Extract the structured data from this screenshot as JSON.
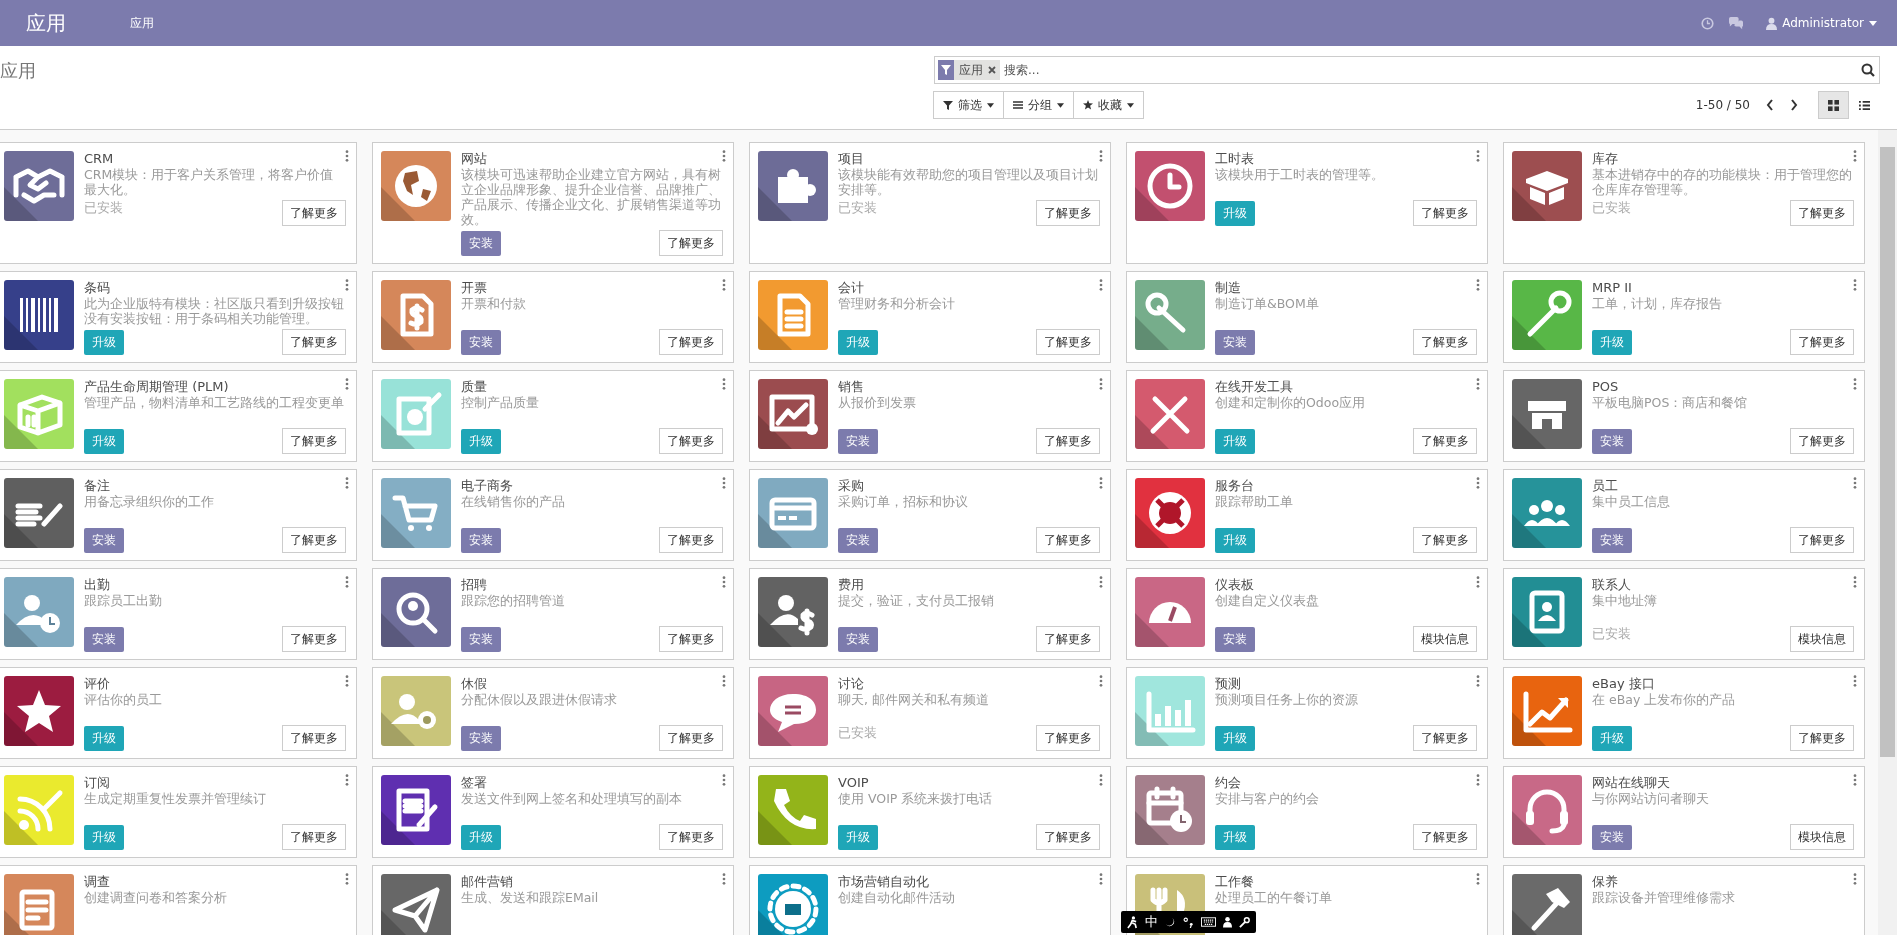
{
  "navbar": {
    "brand": "应用",
    "menu": [
      {
        "label": "应用"
      }
    ],
    "user": "Administrator"
  },
  "control_panel": {
    "breadcrumb": "应用",
    "search": {
      "facet": "应用",
      "placeholder": "搜索..."
    },
    "filters": [
      "筛选",
      "分组",
      "收藏"
    ],
    "pager": "1-50 / 50",
    "views": [
      {
        "kind": "kanban",
        "selected": true
      },
      {
        "kind": "list",
        "selected": false
      }
    ]
  },
  "apps": [
    {
      "name": "CRM",
      "description": "CRM模块：用于客户关系管理，将客户价值最大化。",
      "kind": "installed",
      "action": "已安装",
      "more": "了解更多",
      "color": "#6e6d98"
    },
    {
      "name": "网站",
      "description": "该模块可迅速帮助企业建立官方网站，具有树立企业品牌形象、提升企业信誉、品牌推广、产品展示、传播企业文化、扩展销售渠道等功效。",
      "kind": "install",
      "action": "安装",
      "more": "了解更多",
      "color": "#d5875a"
    },
    {
      "name": "项目",
      "description": "该模块能有效帮助您的项目管理以及项目计划安排等。",
      "kind": "installed",
      "action": "已安装",
      "more": "了解更多",
      "color": "#6d6c97"
    },
    {
      "name": "工时表",
      "description": "该模块用于工时表的管理等。",
      "kind": "upgrade",
      "action": "升级",
      "more": "了解更多",
      "color": "#c2506f"
    },
    {
      "name": "库存",
      "description": "基本进销存中的存的功能模块：用于管理您的仓库库存管理等。",
      "kind": "installed",
      "action": "已安装",
      "more": "了解更多",
      "color": "#9d4e50"
    },
    {
      "name": "条码",
      "description": "此为企业版特有模块：社区版只看到升级按钮没有安装按钮：用于条码相关功能管理。",
      "kind": "upgrade",
      "action": "升级",
      "more": "了解更多",
      "color": "#36408a"
    },
    {
      "name": "开票",
      "description": "开票和付款",
      "kind": "install",
      "action": "安装",
      "more": "了解更多",
      "color": "#d5875a"
    },
    {
      "name": "会计",
      "description": "管理财务和分析会计",
      "kind": "upgrade",
      "action": "升级",
      "more": "了解更多",
      "color": "#f29a30"
    },
    {
      "name": "制造",
      "description": "制造订单&BOM单",
      "kind": "install",
      "action": "安装",
      "more": "了解更多",
      "color": "#76ad8b"
    },
    {
      "name": "MRP II",
      "description": "工单，计划，库存报告",
      "kind": "upgrade",
      "action": "升级",
      "more": "了解更多",
      "color": "#58b747"
    },
    {
      "name": "产品生命周期管理 (PLM)",
      "description": "管理产品，物料清单和工艺路线的工程变更单",
      "kind": "upgrade",
      "action": "升级",
      "more": "了解更多",
      "color": "#a2e05e"
    },
    {
      "name": "质量",
      "description": "控制产品质量",
      "kind": "upgrade",
      "action": "升级",
      "more": "了解更多",
      "color": "#98e2d8"
    },
    {
      "name": "销售",
      "description": "从报价到发票",
      "kind": "install",
      "action": "安装",
      "more": "了解更多",
      "color": "#9b4c4f"
    },
    {
      "name": "在线开发工具",
      "description": "创建和定制你的Odoo应用",
      "kind": "upgrade",
      "action": "升级",
      "more": "了解更多",
      "color": "#d45a6e"
    },
    {
      "name": "POS",
      "description": "平板电脑POS：商店和餐馆",
      "kind": "install",
      "action": "安装",
      "more": "了解更多",
      "color": "#666666"
    },
    {
      "name": "备注",
      "description": "用备忘录组织你的工作",
      "kind": "install",
      "action": "安装",
      "more": "了解更多",
      "color": "#5f5f5f"
    },
    {
      "name": "电子商务",
      "description": "在线销售你的产品",
      "kind": "install",
      "action": "安装",
      "more": "了解更多",
      "color": "#84aec4"
    },
    {
      "name": "采购",
      "description": "采购订单，招标和协议",
      "kind": "install",
      "action": "安装",
      "more": "了解更多",
      "color": "#80aac0"
    },
    {
      "name": "服务台",
      "description": "跟踪帮助工单",
      "kind": "upgrade",
      "action": "升级",
      "more": "了解更多",
      "color": "#e1313f"
    },
    {
      "name": "员工",
      "description": "集中员工信息",
      "kind": "install",
      "action": "安装",
      "more": "了解更多",
      "color": "#26939a"
    },
    {
      "name": "出勤",
      "description": "跟踪员工出勤",
      "kind": "install",
      "action": "安装",
      "more": "了解更多",
      "color": "#7fa9bf"
    },
    {
      "name": "招聘",
      "description": "跟踪您的招聘管道",
      "kind": "install",
      "action": "安装",
      "more": "了解更多",
      "color": "#6e6d99"
    },
    {
      "name": "费用",
      "description": "提交，验证，支付员工报销",
      "kind": "install",
      "action": "安装",
      "more": "了解更多",
      "color": "#626262"
    },
    {
      "name": "仪表板",
      "description": "创建自定义仪表盘",
      "kind": "install",
      "action": "安装",
      "more": "模块信息",
      "color": "#c96785"
    },
    {
      "name": "联系人",
      "description": "集中地址簿",
      "kind": "installed",
      "action": "已安装",
      "more": "模块信息",
      "color": "#228e94"
    },
    {
      "name": "评价",
      "description": "评估你的员工",
      "kind": "upgrade",
      "action": "升级",
      "more": "了解更多",
      "color": "#9c1c40"
    },
    {
      "name": "休假",
      "description": "分配休假以及跟进休假请求",
      "kind": "install",
      "action": "安装",
      "more": "了解更多",
      "color": "#c9c57a"
    },
    {
      "name": "讨论",
      "description": "聊天, 邮件网关和私有频道",
      "kind": "installed",
      "action": "已安装",
      "more": "了解更多",
      "color": "#c76583"
    },
    {
      "name": "预测",
      "description": "预测项目任务上你的资源",
      "kind": "upgrade",
      "action": "升级",
      "more": "了解更多",
      "color": "#a0e6dd"
    },
    {
      "name": "eBay 接口",
      "description": "在 eBay 上发布你的产品",
      "kind": "upgrade",
      "action": "升级",
      "more": "了解更多",
      "color": "#e8640f"
    },
    {
      "name": "订阅",
      "description": "生成定期重复性发票并管理续订",
      "kind": "upgrade",
      "action": "升级",
      "more": "了解更多",
      "color": "#eaea2e"
    },
    {
      "name": "签署",
      "description": "发送文件到网上签名和处理填写的副本",
      "kind": "upgrade",
      "action": "升级",
      "more": "了解更多",
      "color": "#5f2fb0"
    },
    {
      "name": "VOIP",
      "description": "使用 VOIP 系统来拨打电话",
      "kind": "upgrade",
      "action": "升级",
      "more": "了解更多",
      "color": "#93b41a"
    },
    {
      "name": "约会",
      "description": "安排与客户的约会",
      "kind": "upgrade",
      "action": "升级",
      "more": "了解更多",
      "color": "#a57f8c"
    },
    {
      "name": "网站在线聊天",
      "description": "与你网站访问者聊天",
      "kind": "install",
      "action": "安装",
      "more": "模块信息",
      "color": "#c86987"
    },
    {
      "name": "调查",
      "description": "创建调查问卷和答案分析",
      "color": "#d5875b"
    },
    {
      "name": "邮件营销",
      "description": "生成、发送和跟踪EMail",
      "color": "#676767"
    },
    {
      "name": "市场营销自动化",
      "description": "创建自动化邮件活动",
      "color": "#0d9cc0"
    },
    {
      "name": "工作餐",
      "description": "处理员工的午餐订单",
      "color": "#c9c07a"
    },
    {
      "name": "保养",
      "description": "跟踪设备并管理维修需求",
      "color": "#6a6a6a"
    }
  ],
  "ime_toolbar": {
    "mode": "中"
  }
}
